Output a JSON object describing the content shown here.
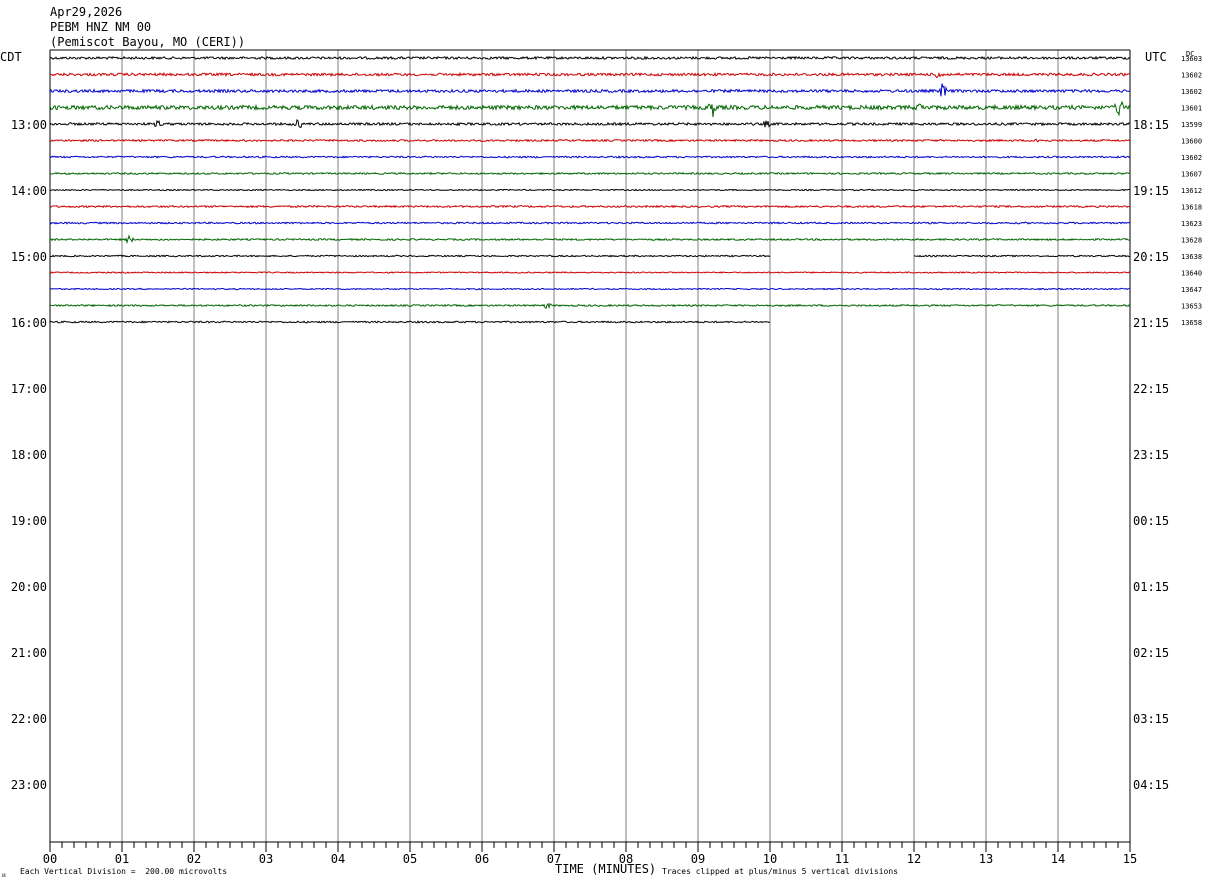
{
  "header": {
    "date": "Apr29,2026",
    "station": "PEBM HNZ NM 00",
    "location": "(Pemiscot Bayou, MO (CERI))"
  },
  "labels": {
    "left_tz": "CDT",
    "right_tz": "UTC",
    "dc": "DC"
  },
  "footer": {
    "xlabel": "TIME (MINUTES)",
    "scale_note": "Each Vertical Division =  200.00 microvolts",
    "clip_note": "Traces clipped at plus/minus 5 vertical divisions",
    "corner": "ᴎ"
  },
  "colors": {
    "trace_cycle": [
      "#000000",
      "#cc0000",
      "#0000cc",
      "#006600"
    ],
    "grid": "#808080",
    "axis": "#000000"
  },
  "chart_data": {
    "type": "line",
    "title": "PEBM HNZ NM 00",
    "xlabel": "TIME (MINUTES)",
    "xlim": [
      0,
      15
    ],
    "x_ticks": [
      "00",
      "01",
      "02",
      "03",
      "04",
      "05",
      "06",
      "07",
      "08",
      "09",
      "10",
      "11",
      "12",
      "13",
      "14",
      "15"
    ],
    "rows_total": 48,
    "row_minutes": 15,
    "left_hour_labels": [
      "13:00",
      "14:00",
      "15:00",
      "16:00",
      "17:00",
      "18:00",
      "19:00",
      "20:00",
      "21:00",
      "22:00",
      "23:00"
    ],
    "right_hour_labels": [
      "18:15",
      "19:15",
      "20:15",
      "21:15",
      "22:15",
      "23:15",
      "00:15",
      "01:15",
      "02:15",
      "03:15",
      "04:15"
    ],
    "traces": [
      {
        "dc": "13603",
        "start_min": 0,
        "end_min": 15,
        "noise": 1.2
      },
      {
        "dc": "13602",
        "start_min": 0,
        "end_min": 15,
        "noise": 1.3,
        "events": [
          {
            "t": 12.35,
            "amp": 5
          }
        ]
      },
      {
        "dc": "13602",
        "start_min": 0,
        "end_min": 15,
        "noise": 1.4,
        "events": [
          {
            "t": 12.4,
            "amp": 8
          }
        ]
      },
      {
        "dc": "13601",
        "start_min": 0,
        "end_min": 15,
        "noise": 2.0,
        "events": [
          {
            "t": 9.2,
            "amp": 9
          },
          {
            "t": 12.1,
            "amp": 4
          },
          {
            "t": 14.85,
            "amp": 9
          }
        ]
      },
      {
        "dc": "13599",
        "start_min": 0,
        "end_min": 15,
        "noise": 1.2,
        "events": [
          {
            "t": 1.5,
            "amp": 3
          },
          {
            "t": 3.45,
            "amp": 5
          },
          {
            "t": 9.95,
            "amp": 3
          }
        ]
      },
      {
        "dc": "13600",
        "start_min": 0,
        "end_min": 15,
        "noise": 0.9,
        "events": [
          {
            "t": 13.7,
            "amp": 3
          }
        ]
      },
      {
        "dc": "13602",
        "start_min": 0,
        "end_min": 15,
        "noise": 0.8
      },
      {
        "dc": "13607",
        "start_min": 0,
        "end_min": 15,
        "noise": 0.8
      },
      {
        "dc": "13612",
        "start_min": 0,
        "end_min": 15,
        "noise": 0.6
      },
      {
        "dc": "13618",
        "start_min": 0,
        "end_min": 15,
        "noise": 0.9
      },
      {
        "dc": "13623",
        "start_min": 0,
        "end_min": 15,
        "noise": 0.8
      },
      {
        "dc": "13628",
        "start_min": 0,
        "end_min": 15,
        "noise": 0.8,
        "events": [
          {
            "t": 1.1,
            "amp": 4
          }
        ]
      },
      {
        "dc": "13638",
        "start_min": 0,
        "end_min": 15,
        "noise": 0.7,
        "gap": [
          10.0,
          12.0
        ]
      },
      {
        "dc": "13640",
        "start_min": 0,
        "end_min": 15,
        "noise": 0.6
      },
      {
        "dc": "13647",
        "start_min": 0,
        "end_min": 15,
        "noise": 0.6
      },
      {
        "dc": "13653",
        "start_min": 0,
        "end_min": 15,
        "noise": 0.8,
        "events": [
          {
            "t": 6.9,
            "amp": 3
          }
        ]
      },
      {
        "dc": "13658",
        "start_min": 0,
        "end_min": 10,
        "noise": 0.8
      }
    ]
  }
}
